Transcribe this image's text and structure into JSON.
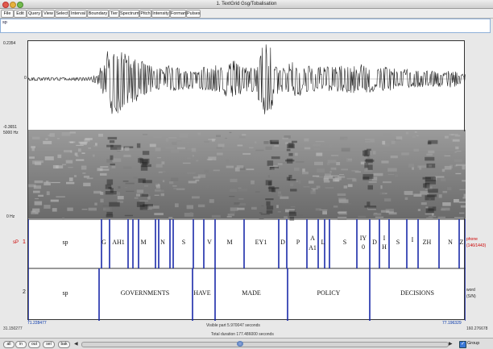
{
  "window": {
    "title": "1. TextGrid Gsg/Tobalisation"
  },
  "menu": [
    "File",
    "Edit",
    "Query",
    "View",
    "Select",
    "Interval",
    "Boundary",
    "Tier",
    "Spectrum",
    "Pitch",
    "Intensity",
    "Formant",
    "Pulses"
  ],
  "text_field": {
    "value": "sp"
  },
  "waveform": {
    "max_label": "0.2354",
    "zero_label": "0",
    "min_label": "-0.3651"
  },
  "spectrogram": {
    "max_label": "5000 Hz",
    "min_label": "0 Hz"
  },
  "tier1": {
    "number": "1",
    "side_label": "sP",
    "right_label_1": "phone",
    "right_label_2": "(146/1443)",
    "intervals": [
      "sp",
      "G",
      "AH1",
      "M",
      "N",
      "S",
      "V",
      "M",
      "EY1",
      "D",
      "P",
      "A",
      "L",
      "S",
      "IY",
      "D",
      "I",
      "S",
      "I",
      "ZH",
      "N",
      "Z"
    ],
    "subscripts": [
      "A1",
      "0",
      "H"
    ]
  },
  "tier2": {
    "number": "2",
    "right_label_1": "word",
    "right_label_2": "(S/N)",
    "intervals": [
      "sp",
      "GOVERNMENTS",
      "HAVE",
      "MADE",
      "POLICY",
      "DECISIONS"
    ]
  },
  "times": {
    "left": "71.228477",
    "right": "77.196329",
    "far_left": "31.150277",
    "far_right": "160.276678"
  },
  "segments": {
    "visible_part": "Visible part 5.970047 seconds",
    "total_duration": "Total duration 177.486000 seconds"
  },
  "bottom": {
    "buttons": [
      "all",
      "in",
      "out",
      "sel",
      "bak"
    ],
    "group_label": "Group"
  }
}
